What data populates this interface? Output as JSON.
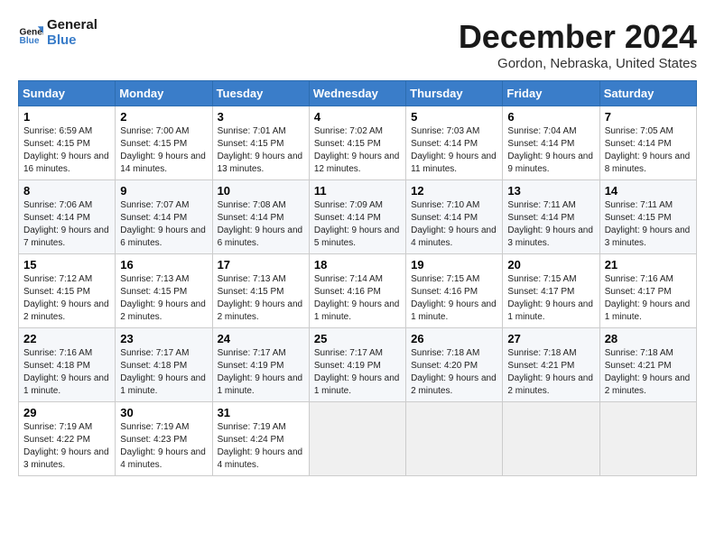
{
  "header": {
    "logo_line1": "General",
    "logo_line2": "Blue",
    "month_title": "December 2024",
    "location": "Gordon, Nebraska, United States"
  },
  "weekdays": [
    "Sunday",
    "Monday",
    "Tuesday",
    "Wednesday",
    "Thursday",
    "Friday",
    "Saturday"
  ],
  "weeks": [
    [
      {
        "day": "1",
        "info": "Sunrise: 6:59 AM\nSunset: 4:15 PM\nDaylight: 9 hours and 16 minutes."
      },
      {
        "day": "2",
        "info": "Sunrise: 7:00 AM\nSunset: 4:15 PM\nDaylight: 9 hours and 14 minutes."
      },
      {
        "day": "3",
        "info": "Sunrise: 7:01 AM\nSunset: 4:15 PM\nDaylight: 9 hours and 13 minutes."
      },
      {
        "day": "4",
        "info": "Sunrise: 7:02 AM\nSunset: 4:15 PM\nDaylight: 9 hours and 12 minutes."
      },
      {
        "day": "5",
        "info": "Sunrise: 7:03 AM\nSunset: 4:14 PM\nDaylight: 9 hours and 11 minutes."
      },
      {
        "day": "6",
        "info": "Sunrise: 7:04 AM\nSunset: 4:14 PM\nDaylight: 9 hours and 9 minutes."
      },
      {
        "day": "7",
        "info": "Sunrise: 7:05 AM\nSunset: 4:14 PM\nDaylight: 9 hours and 8 minutes."
      }
    ],
    [
      {
        "day": "8",
        "info": "Sunrise: 7:06 AM\nSunset: 4:14 PM\nDaylight: 9 hours and 7 minutes."
      },
      {
        "day": "9",
        "info": "Sunrise: 7:07 AM\nSunset: 4:14 PM\nDaylight: 9 hours and 6 minutes."
      },
      {
        "day": "10",
        "info": "Sunrise: 7:08 AM\nSunset: 4:14 PM\nDaylight: 9 hours and 6 minutes."
      },
      {
        "day": "11",
        "info": "Sunrise: 7:09 AM\nSunset: 4:14 PM\nDaylight: 9 hours and 5 minutes."
      },
      {
        "day": "12",
        "info": "Sunrise: 7:10 AM\nSunset: 4:14 PM\nDaylight: 9 hours and 4 minutes."
      },
      {
        "day": "13",
        "info": "Sunrise: 7:11 AM\nSunset: 4:14 PM\nDaylight: 9 hours and 3 minutes."
      },
      {
        "day": "14",
        "info": "Sunrise: 7:11 AM\nSunset: 4:15 PM\nDaylight: 9 hours and 3 minutes."
      }
    ],
    [
      {
        "day": "15",
        "info": "Sunrise: 7:12 AM\nSunset: 4:15 PM\nDaylight: 9 hours and 2 minutes."
      },
      {
        "day": "16",
        "info": "Sunrise: 7:13 AM\nSunset: 4:15 PM\nDaylight: 9 hours and 2 minutes."
      },
      {
        "day": "17",
        "info": "Sunrise: 7:13 AM\nSunset: 4:15 PM\nDaylight: 9 hours and 2 minutes."
      },
      {
        "day": "18",
        "info": "Sunrise: 7:14 AM\nSunset: 4:16 PM\nDaylight: 9 hours and 1 minute."
      },
      {
        "day": "19",
        "info": "Sunrise: 7:15 AM\nSunset: 4:16 PM\nDaylight: 9 hours and 1 minute."
      },
      {
        "day": "20",
        "info": "Sunrise: 7:15 AM\nSunset: 4:17 PM\nDaylight: 9 hours and 1 minute."
      },
      {
        "day": "21",
        "info": "Sunrise: 7:16 AM\nSunset: 4:17 PM\nDaylight: 9 hours and 1 minute."
      }
    ],
    [
      {
        "day": "22",
        "info": "Sunrise: 7:16 AM\nSunset: 4:18 PM\nDaylight: 9 hours and 1 minute."
      },
      {
        "day": "23",
        "info": "Sunrise: 7:17 AM\nSunset: 4:18 PM\nDaylight: 9 hours and 1 minute."
      },
      {
        "day": "24",
        "info": "Sunrise: 7:17 AM\nSunset: 4:19 PM\nDaylight: 9 hours and 1 minute."
      },
      {
        "day": "25",
        "info": "Sunrise: 7:17 AM\nSunset: 4:19 PM\nDaylight: 9 hours and 1 minute."
      },
      {
        "day": "26",
        "info": "Sunrise: 7:18 AM\nSunset: 4:20 PM\nDaylight: 9 hours and 2 minutes."
      },
      {
        "day": "27",
        "info": "Sunrise: 7:18 AM\nSunset: 4:21 PM\nDaylight: 9 hours and 2 minutes."
      },
      {
        "day": "28",
        "info": "Sunrise: 7:18 AM\nSunset: 4:21 PM\nDaylight: 9 hours and 2 minutes."
      }
    ],
    [
      {
        "day": "29",
        "info": "Sunrise: 7:19 AM\nSunset: 4:22 PM\nDaylight: 9 hours and 3 minutes."
      },
      {
        "day": "30",
        "info": "Sunrise: 7:19 AM\nSunset: 4:23 PM\nDaylight: 9 hours and 4 minutes."
      },
      {
        "day": "31",
        "info": "Sunrise: 7:19 AM\nSunset: 4:24 PM\nDaylight: 9 hours and 4 minutes."
      },
      null,
      null,
      null,
      null
    ]
  ]
}
